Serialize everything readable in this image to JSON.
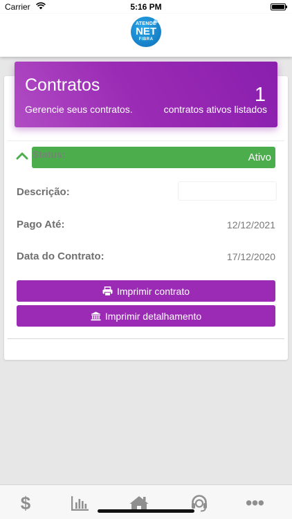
{
  "status": {
    "carrier": "Carrier",
    "time": "5:16 PM"
  },
  "logo": {
    "line1": "ATENDE",
    "line2": "NET",
    "line3": "FIBRA"
  },
  "banner": {
    "title": "Contratos",
    "subtitle": "Gerencie seus contratos.",
    "count": "1",
    "count_label": "contratos ativos listados"
  },
  "contract": {
    "status_label": "Status:",
    "status_value": "Ativo",
    "description_label": "Descrição:",
    "description_value": "",
    "paid_until_label": "Pago Até:",
    "paid_until_value": "12/12/2021",
    "contract_date_label": "Data do Contrato:",
    "contract_date_value": "17/12/2020"
  },
  "buttons": {
    "print_contract": "Imprimir contrato",
    "print_details": "Imprimir detalhamento"
  },
  "tabs": [
    {
      "icon": "dollar-icon",
      "glyph": "$"
    },
    {
      "icon": "chart-icon"
    },
    {
      "icon": "home-icon"
    },
    {
      "icon": "headset-icon"
    },
    {
      "icon": "more-icon",
      "glyph": "•••"
    }
  ],
  "colors": {
    "accent_purple": "#9b2bb5",
    "status_green": "#4cad4d"
  }
}
